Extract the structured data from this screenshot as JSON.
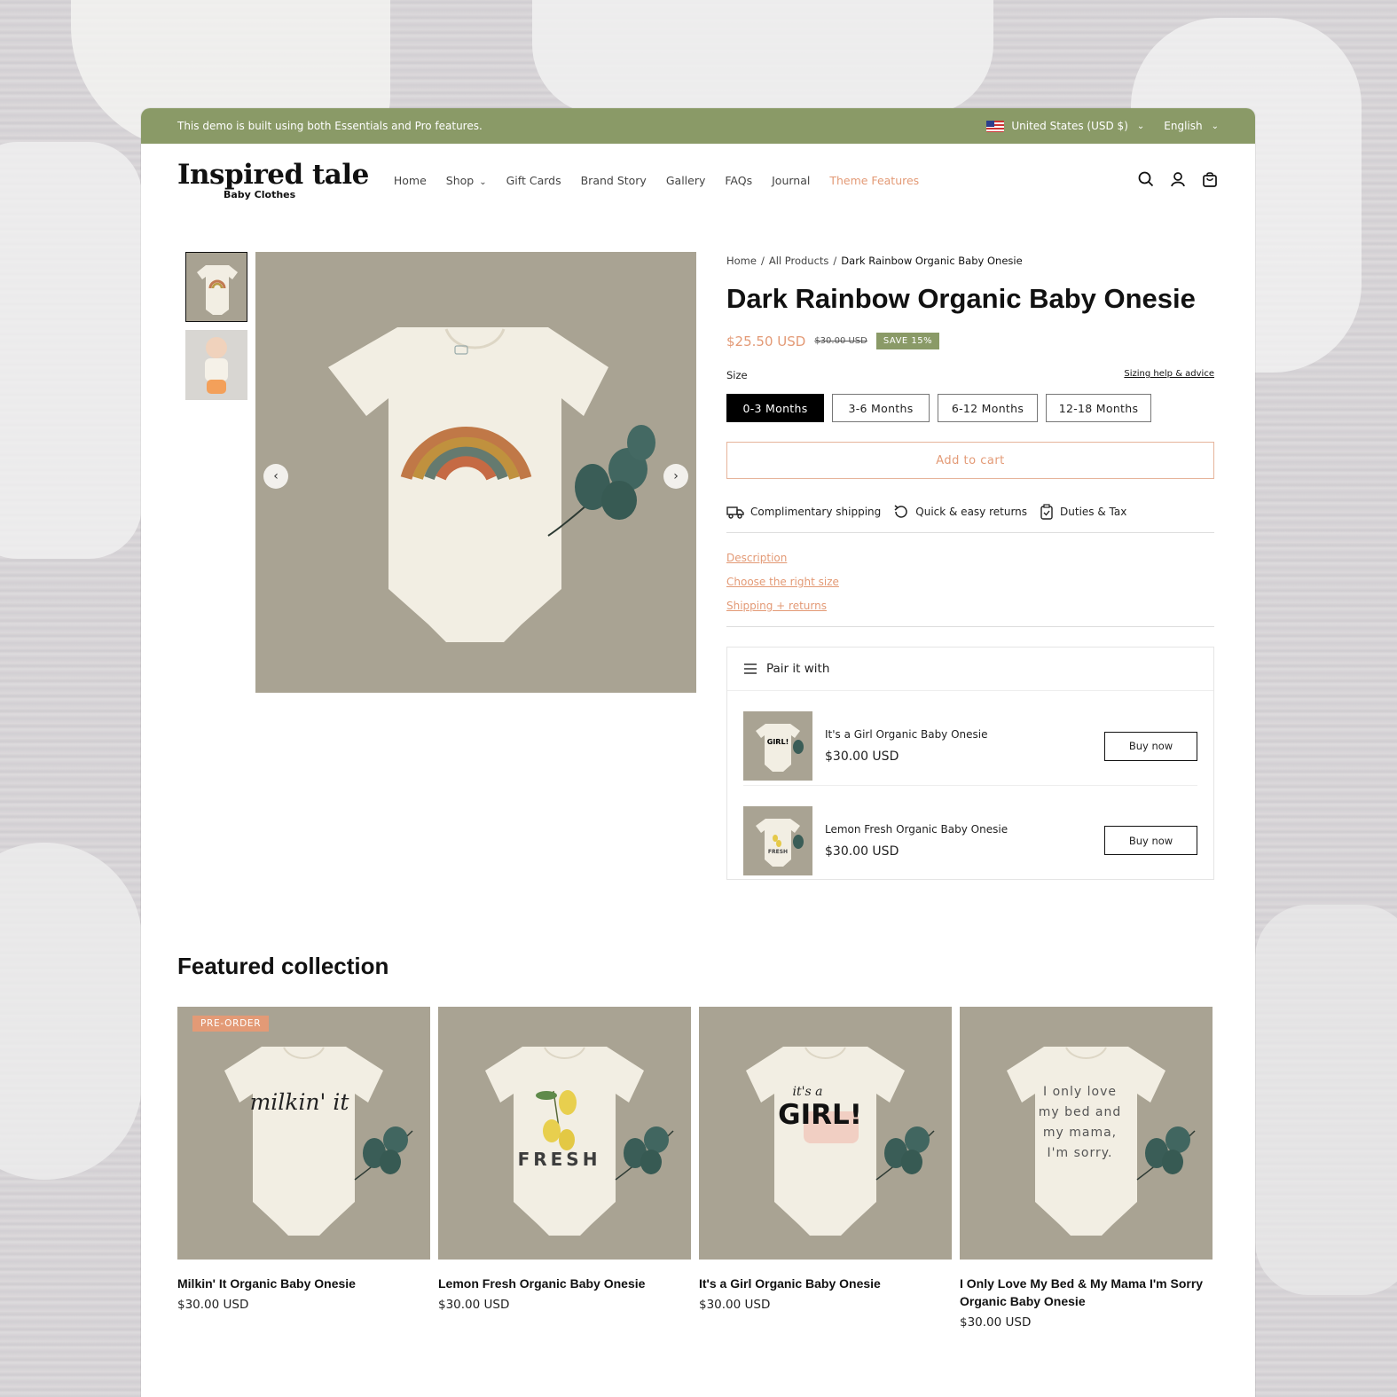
{
  "announcement": {
    "text": "This demo is built using both Essentials and Pro features.",
    "country": "United States (USD $)",
    "language": "English"
  },
  "header": {
    "logo_main": "Inspired tale",
    "logo_sub": "Baby Clothes",
    "nav": [
      "Home",
      "Shop",
      "Gift Cards",
      "Brand Story",
      "Gallery",
      "FAQs",
      "Journal",
      "Theme Features"
    ],
    "icons": [
      "search-icon",
      "account-icon",
      "cart-icon"
    ]
  },
  "product": {
    "breadcrumb": [
      "Home",
      "All Products",
      "Dark Rainbow Organic Baby Onesie"
    ],
    "title": "Dark Rainbow Organic Baby Onesie",
    "price": "$25.50 USD",
    "compare_price": "$30.00 USD",
    "save_badge": "SAVE 15%",
    "size_label": "Size",
    "size_help": "Sizing help & advice",
    "sizes": [
      "0-3 Months",
      "3-6 Months",
      "6-12 Months",
      "12-18 Months"
    ],
    "selected_size": "0-3 Months",
    "add_to_cart": "Add to cart",
    "features": [
      "Complimentary shipping",
      "Quick & easy returns",
      "Duties & Tax"
    ],
    "links": [
      "Description",
      "Choose the right size",
      "Shipping + returns"
    ],
    "accent_color": "#e39a76",
    "brand_color": "#8a9a67"
  },
  "pair": {
    "heading": "Pair it with",
    "items": [
      {
        "name": "It's a Girl Organic Baby Onesie",
        "price": "$30.00 USD",
        "button": "Buy now"
      },
      {
        "name": "Lemon Fresh Organic Baby Onesie",
        "price": "$30.00 USD",
        "button": "Buy now"
      }
    ]
  },
  "featured": {
    "heading": "Featured collection",
    "items": [
      {
        "name": "Milkin' It Organic Baby Onesie",
        "price": "$30.00 USD",
        "badge": "PRE-ORDER",
        "print": "milkin' it"
      },
      {
        "name": "Lemon Fresh Organic Baby Onesie",
        "price": "$30.00 USD",
        "print": "FRESH"
      },
      {
        "name": "It's a Girl Organic Baby Onesie",
        "price": "$30.00 USD",
        "print_small": "it's a",
        "print": "GIRL!"
      },
      {
        "name": "I Only Love My Bed & My Mama I'm Sorry Organic Baby Onesie",
        "price": "$30.00 USD",
        "print_lines": [
          "I only love",
          "my bed and",
          "my mama,",
          "I'm sorry."
        ]
      }
    ]
  }
}
